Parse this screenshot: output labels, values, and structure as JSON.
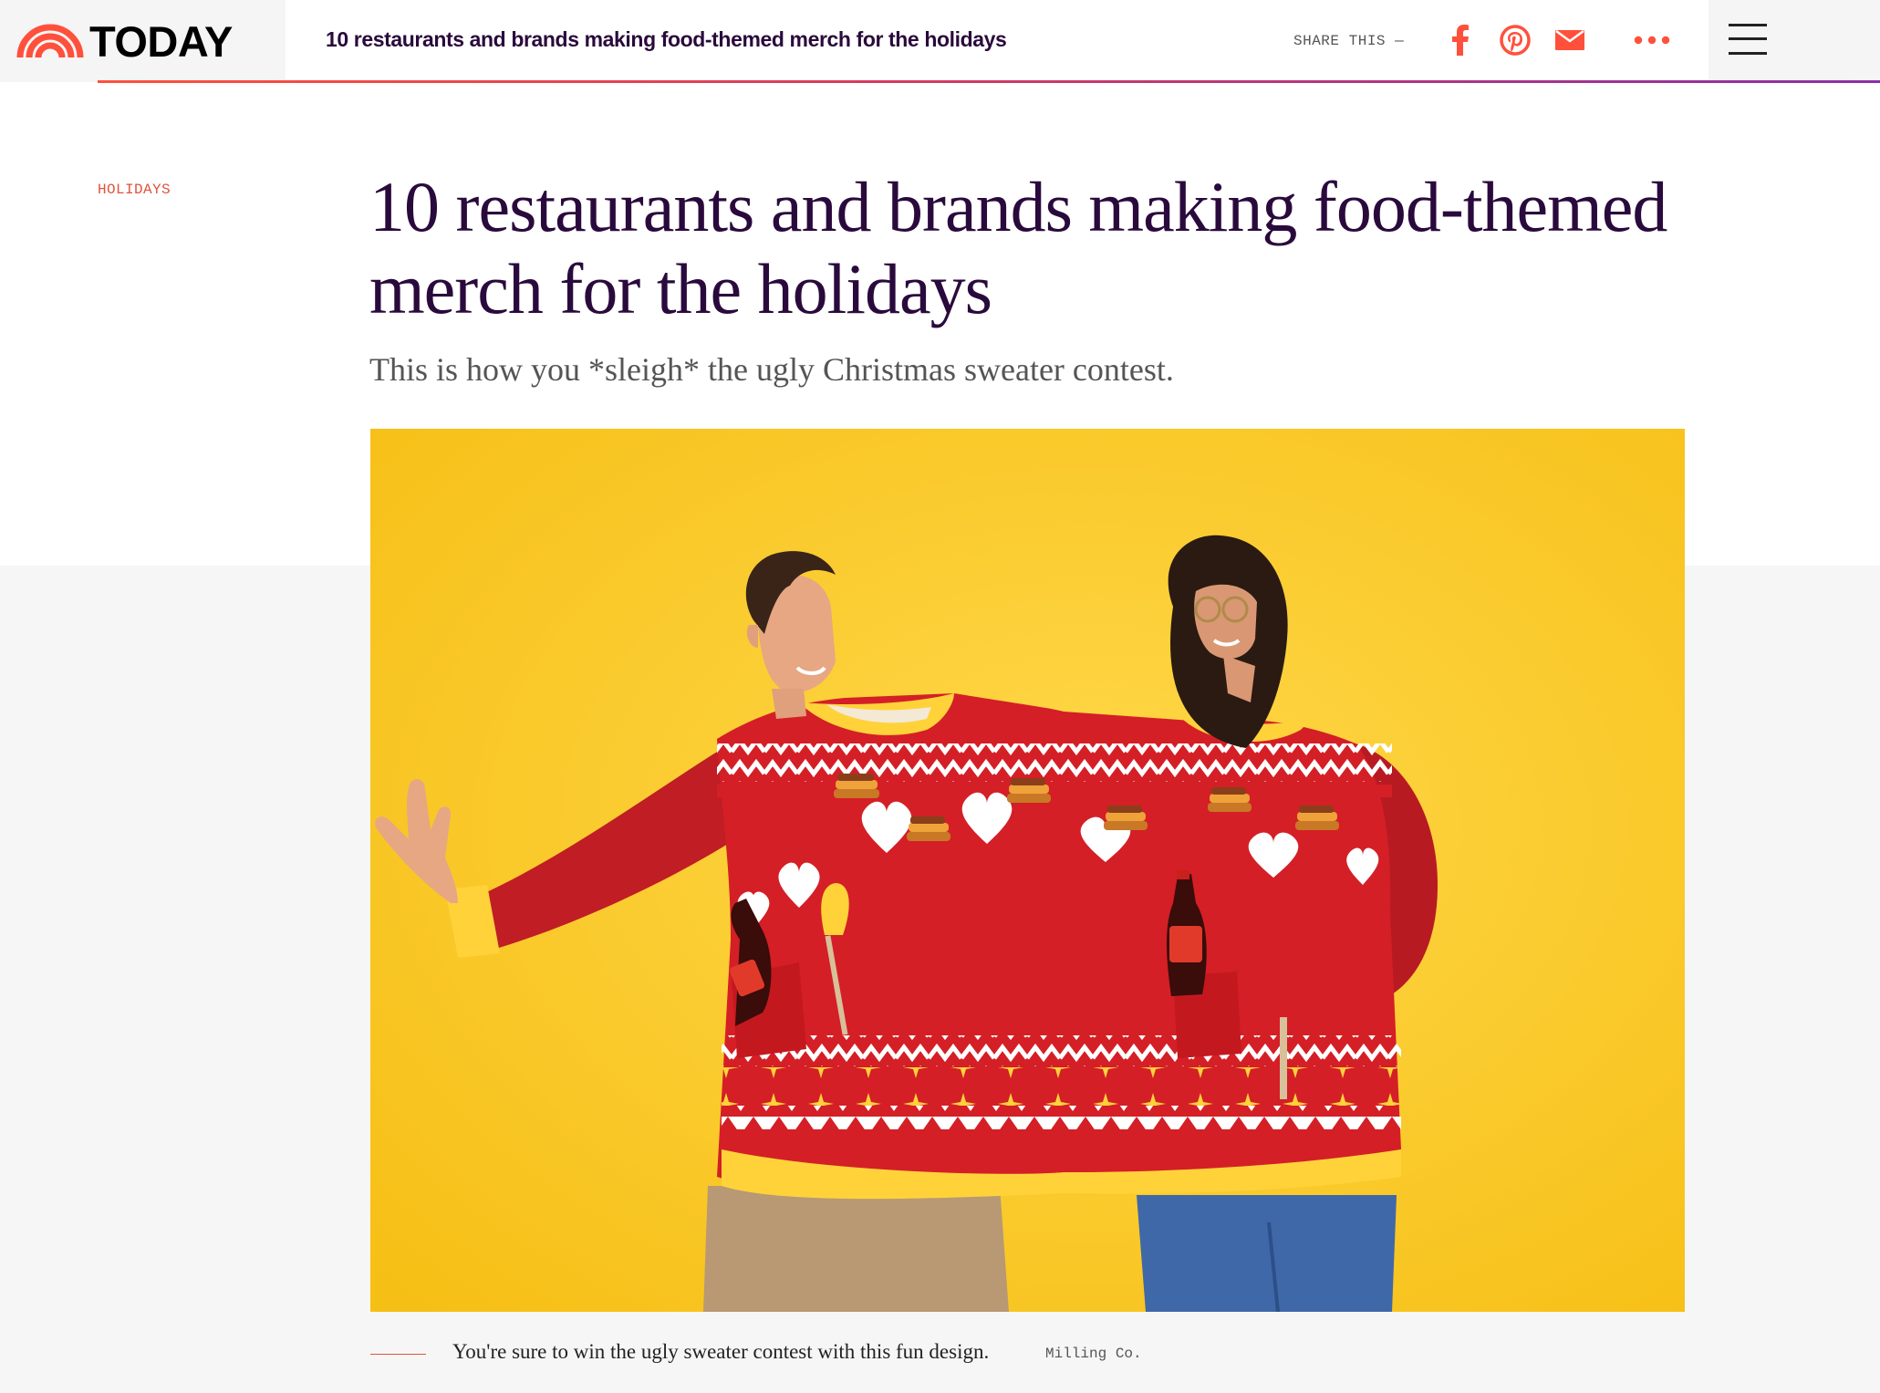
{
  "header": {
    "logo_text": "TODAY",
    "article_title": "10 restaurants and brands making food-themed merch for the holidays",
    "share_label": "SHARE THIS —",
    "share_icons": [
      "facebook-icon",
      "pinterest-icon",
      "email-icon",
      "more-icon"
    ],
    "menu_icon": "hamburger-menu-icon"
  },
  "article": {
    "eyebrow": "HOLIDAYS",
    "headline": "10 restaurants and brands making food-themed merch for the holidays",
    "dek": "This is how you *sleigh* the ugly Christmas sweater contest.",
    "image_alt": "Two people wearing a joined red and yellow holiday sweater with pancake and syrup designs",
    "caption": "You're sure to win the ugly sweater contest with this fun design.",
    "credit": "Milling Co."
  },
  "colors": {
    "brand_orange": "#ff503c",
    "headline_purple": "#2a0a3c",
    "gradient_end": "#8b2fa6",
    "hero_yellow": "#f8c51c",
    "sweater_red": "#d41f26"
  }
}
